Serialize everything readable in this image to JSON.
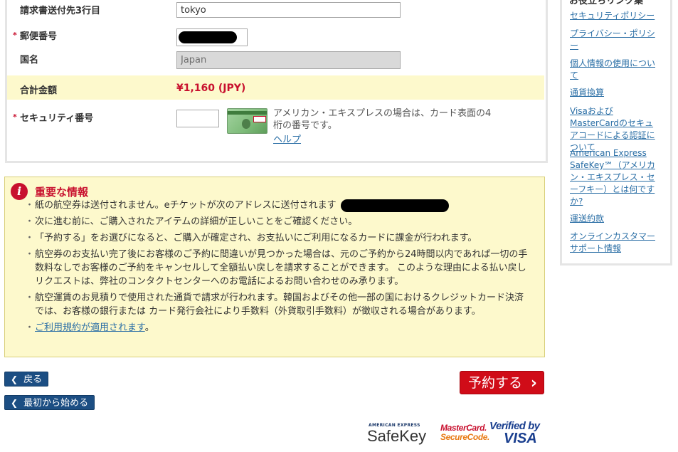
{
  "form": {
    "address3_label": "請求書送付先3行目",
    "address3_value": "tokyo",
    "postal_label": "郵便番号",
    "country_label": "国名",
    "country_value": "Japan",
    "total_label": "合計金額",
    "total_value": "¥1,160 (JPY)",
    "security_label": "セキュリティ番号",
    "security_help": "アメリカン・エキスプレスの場合は、カード表面の4桁の番号です。",
    "help_link": "ヘルプ",
    "required_mark": "*"
  },
  "important": {
    "title": "重要な情報",
    "items": [
      "紙の航空券は送付されません。eチケットが次のアドレスに送付されます",
      "次に進む前に、ご購入されたアイテムの詳細が正しいことをご確認ください。",
      "「予約する」をお選びになると、ご購入が確定され、お支払いにご利用になるカードに課金が行われます。",
      "航空券のお支払い完了後にお客様のご予約に間違いが見つかった場合は、元のご予約から24時間以内であれば一切の手数料なしでお客様のご予約をキャンセルして全額払い戻しを請求することができます。 このような理由による払い戻しリクエストは、弊社のコンタクトセンターへのお電話によるお問い合わせのみ承ります。",
      "航空運賃のお見積りで使用された通貨で請求が行われます。韓国およびその他一部の国におけるクレジットカード決済では、お客様の銀行または カード発行会社により手数料（外貨取引手数料）が徴収される場合があります。"
    ],
    "terms_link": "ご利用規約が適用されます",
    "terms_suffix": "。"
  },
  "buttons": {
    "back": "戻る",
    "restart": "最初から始める",
    "book": "予約する"
  },
  "logos": {
    "safekey_small": "AMERICAN EXPRESS",
    "safekey_big": "SafeKey",
    "mc_line1": "MasterCard.",
    "mc_line2": "SecureCode.",
    "visa_line1": "Verified by",
    "visa_line2": "VISA"
  },
  "sidebar": {
    "title": "お役立ちリンク集",
    "links": [
      "セキュリティポリシー",
      "プライバシー・ポリシー",
      "個人情報の使用について",
      "通貨換算",
      "VisaおよびMasterCardのセキュアコードによる認証について",
      "American Express SafeKey℠（アメリカン・エキスプレス・セーフキー）とは何ですか?",
      "運送約款",
      "オンラインカスタマーサポート情報"
    ]
  },
  "colors": {
    "accent_red": "#c8102e",
    "highlight_yellow": "#fdf9cc",
    "nav_blue": "#1c4e83",
    "link_blue": "#2b6fa6"
  }
}
